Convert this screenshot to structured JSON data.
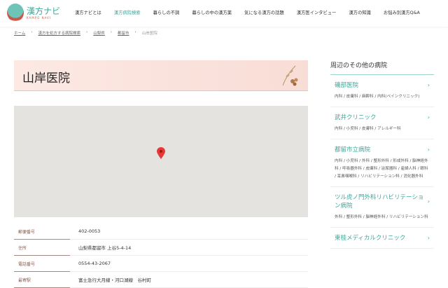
{
  "header": {
    "logo_main": "漢方ナビ",
    "logo_sub": "KAMPO NAVI",
    "nav": [
      "漢方ナビとは",
      "漢方病院検索",
      "暮らしの不調",
      "暮らしの中の漢方薬",
      "気になる漢方の話題",
      "漢方医インタビュー",
      "漢方の知識",
      "お悩み別漢方Q&A"
    ]
  },
  "breadcrumb": [
    "ホーム",
    "漢方を処方する病院検索",
    "山梨県",
    "都留市",
    "山岸医院"
  ],
  "title": "山岸医院",
  "info": [
    {
      "k": "郵便番号",
      "v": "402-0053"
    },
    {
      "k": "住所",
      "v": "山梨県都留市 上谷5-4-14"
    },
    {
      "k": "電話番号",
      "v": "0554-43-2067"
    },
    {
      "k": "最寄駅",
      "v": "富士急行大月線・河口湖線　谷村町"
    }
  ],
  "sidebar": {
    "heading": "周辺のその他の病院",
    "items": [
      {
        "name": "磯部医院",
        "depts": "内科 / 皮膚科 / 麻酔科 / 内科(ペインクリニック)"
      },
      {
        "name": "武井クリニック",
        "depts": "内科 / 小児科 / 皮膚科 / アレルギー科"
      },
      {
        "name": "都留市立病院",
        "depts": "内科 / 小児科 / 外科 / 整形外科 / 形成外科 / 脳神経外科 / 呼吸器外科 / 皮膚科 / 泌尿器科 / 産婦人科 / 眼科 / 耳鼻咽喉科 / リハビリテーション科 / 消化器外科"
      },
      {
        "name": "ツル虎ノ門外科リハビリテーション病院",
        "depts": "外科 / 整形外科 / 脳神経外科 / リハビリテーション科"
      },
      {
        "name": "東桂メディカルクリニック",
        "depts": ""
      }
    ]
  },
  "colors": {
    "accent": "#3aa89a",
    "title_band": "#fde9e4"
  }
}
